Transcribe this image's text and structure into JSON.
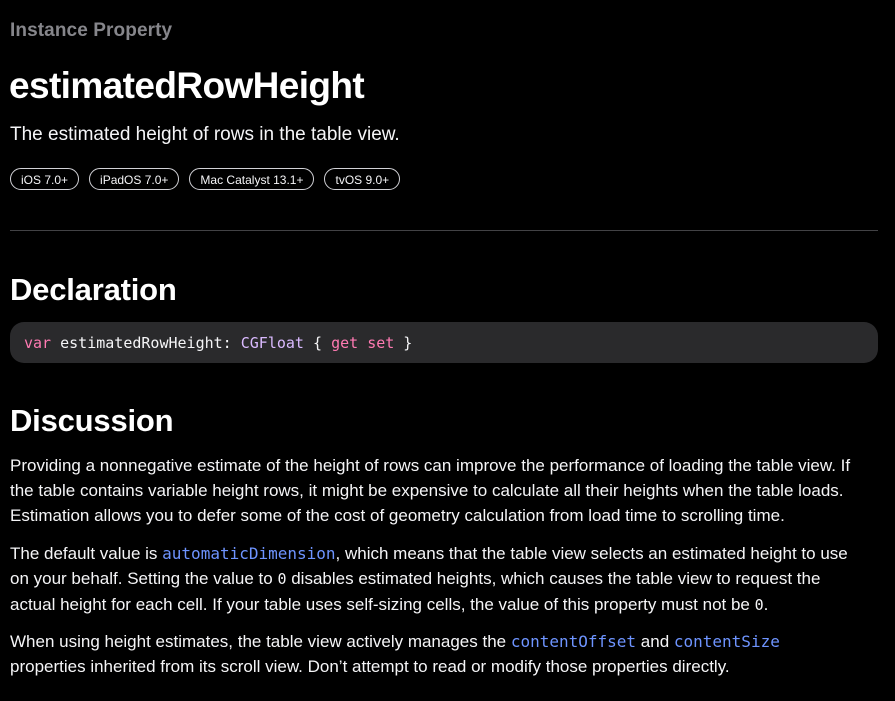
{
  "header": {
    "eyebrow": "Instance Property",
    "title": "estimatedRowHeight",
    "abstract": "The estimated height of rows in the table view."
  },
  "availability": [
    "iOS 7.0+",
    "iPadOS 7.0+",
    "Mac Catalyst 13.1+",
    "tvOS 9.0+"
  ],
  "declaration": {
    "heading": "Declaration",
    "code": {
      "kw_var": "var",
      "name": " estimatedRowHeight: ",
      "type": "CGFloat",
      "brace_open": " { ",
      "kw_get": "get",
      "space": " ",
      "kw_set": "set",
      "brace_close": " }"
    }
  },
  "discussion": {
    "heading": "Discussion",
    "para1": {
      "l1": "Providing a nonnegative estimate of the height of rows can improve the performance of loading the table view. If",
      "l2": "the table contains variable height rows, it might be expensive to calculate all their heights when the table loads.",
      "l3": "Estimation allows you to defer some of the cost of geometry calculation from load time to scrolling time."
    },
    "para2": {
      "l1_a": "The default value is ",
      "l1_link": "automaticDimension",
      "l1_b": ", which means that the table view selects an estimated height to use",
      "l2_a": "on your behalf. Setting the value to ",
      "l2_code": "0",
      "l2_b": " disables estimated heights, which causes the table view to request the",
      "l3_a": "actual height for each cell. If your table uses self-sizing cells, the value of this property must not be ",
      "l3_code": "0",
      "l3_b": "."
    },
    "para3": {
      "l1_a": "When using height estimates, the table view actively manages the ",
      "l1_link1": "contentOffset",
      "l1_b": " and ",
      "l1_link2": "contentSize",
      "l2": "properties inherited from its scroll view. Don’t attempt to read or modify those properties directly."
    }
  },
  "colors": {
    "background": "#000000",
    "link": "#6e94ff",
    "keyword": "#ff7ab2",
    "type": "#dabaff",
    "eyebrow": "#86868b"
  }
}
